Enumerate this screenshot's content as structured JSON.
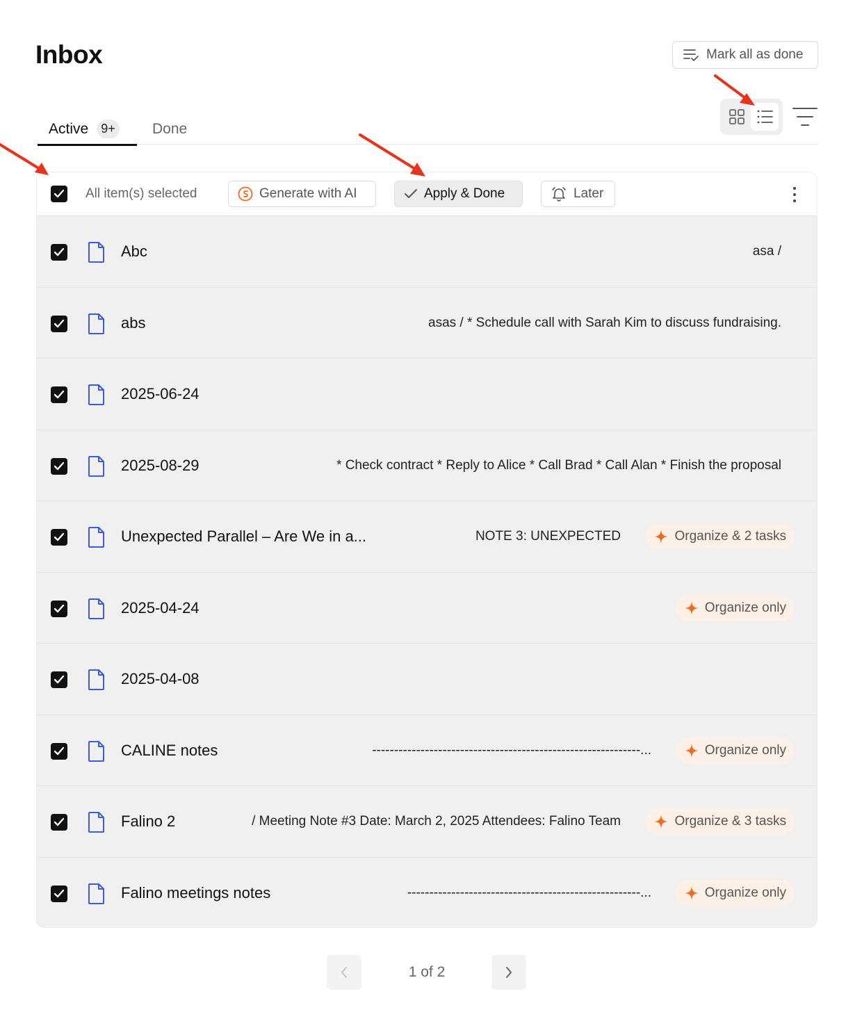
{
  "header": {
    "title": "Inbox",
    "mark_all_label": "Mark all as done"
  },
  "tabs": [
    {
      "label": "Active",
      "badge": "9+",
      "active": true
    },
    {
      "label": "Done",
      "active": false
    }
  ],
  "view_toggle": {
    "options": [
      "grid-icon",
      "list-icon"
    ],
    "selected": "list"
  },
  "toolbar": {
    "selection_label": "All item(s) selected",
    "generate_label": "Generate with AI",
    "apply_label": "Apply & Done",
    "later_label": "Later"
  },
  "rows": [
    {
      "title": "Abc",
      "preview": "asa /",
      "tag": ""
    },
    {
      "title": "abs",
      "preview": "asas / * Schedule call with Sarah Kim to discuss fundraising.",
      "tag": ""
    },
    {
      "title": "2025-06-24",
      "preview": "",
      "tag": ""
    },
    {
      "title": "2025-08-29",
      "preview": "* Check contract * Reply to Alice * Call Brad * Call Alan * Finish the proposal",
      "tag": ""
    },
    {
      "title": "Unexpected Parallel – Are We in a...",
      "preview": "NOTE 3: UNEXPECTED",
      "tag": "Organize & 2 tasks"
    },
    {
      "title": "2025-04-24",
      "preview": "",
      "tag": "Organize only"
    },
    {
      "title": "2025-04-08",
      "preview": "",
      "tag": ""
    },
    {
      "title": "CALINE notes",
      "preview": "-------------------------------------------------------------...",
      "tag": "Organize only"
    },
    {
      "title": "Falino 2",
      "preview": "/ Meeting Note #3 Date: March 2, 2025 Attendees: Falino Team",
      "tag": "Organize & 3 tasks"
    },
    {
      "title": "Falino meetings notes",
      "preview": "-----------------------------------------------------...",
      "tag": "Organize only"
    }
  ],
  "pagination": {
    "label": "1 of 2"
  },
  "colors": {
    "accent_orange": "#f26b21",
    "doc_icon_blue": "#3b5bdb",
    "annotation_red": "#e8331c"
  }
}
